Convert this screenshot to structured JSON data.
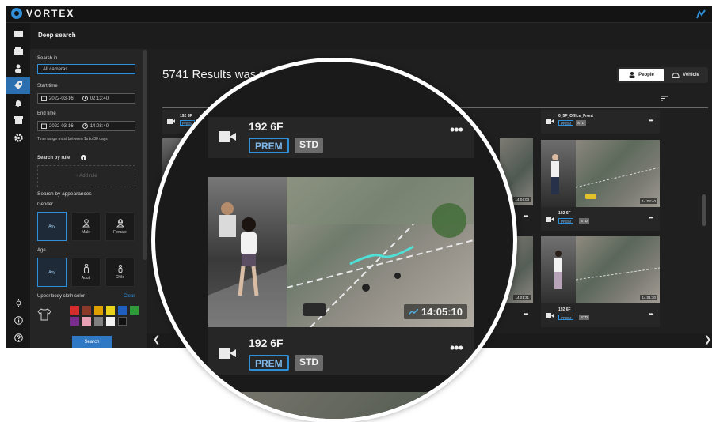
{
  "app": {
    "brand": "VORTEX"
  },
  "panel": {
    "title": "Deep search",
    "search_in_label": "Search in",
    "camera_value": "All cameras",
    "start_time_label": "Start time",
    "start_date": "2022-03-16",
    "start_time": "02:13:40",
    "end_time_label": "End time",
    "end_date": "2022-03-16",
    "end_time": "14:08:40",
    "range_hint": "Time range must between 1s to 30 days",
    "search_by_rule_label": "Search by rule",
    "add_rule_label": "+ Add rule",
    "appearances_label": "Search by appearances",
    "gender_label": "Gender",
    "gender_options": [
      "Any",
      "Male",
      "Female"
    ],
    "age_label": "Age",
    "age_options": [
      "Any",
      "Adult",
      "Child"
    ],
    "cloth_label": "Upper body cloth color",
    "clear_label": "Clear",
    "colors": [
      "#d42d2d",
      "#8b3a2a",
      "#e0a000",
      "#e6d31a",
      "#1f5fbf",
      "#2f9a3a",
      "#7a2c8c",
      "#e8a0b4",
      "#808080",
      "#f2f2f2",
      "#111111"
    ],
    "search_button": "Search"
  },
  "main": {
    "results_text": "5741 Results was found",
    "toggle": {
      "people": "People",
      "vehicle": "Vehicle"
    },
    "cards": [
      {
        "name": "192 6F",
        "prem": "PREM",
        "std": "STD"
      },
      {
        "name": "0_5F_Office_Front",
        "prem": "PREM",
        "std": "STD"
      },
      {
        "name": "192 6F",
        "prem": "PREM",
        "std": "STD",
        "time": "14:03:40"
      },
      {
        "name": "192 6F",
        "prem": "PREM",
        "std": "STD",
        "time": "14:01:30"
      }
    ],
    "partial_times": [
      "14:04:03",
      "14:01:31"
    ]
  },
  "lens": {
    "top_card": {
      "name": "192 6F",
      "prem": "PREM",
      "std": "STD"
    },
    "feature_card": {
      "name": "192 6F",
      "prem": "PREM",
      "std": "STD",
      "time": "14:05:10"
    }
  }
}
